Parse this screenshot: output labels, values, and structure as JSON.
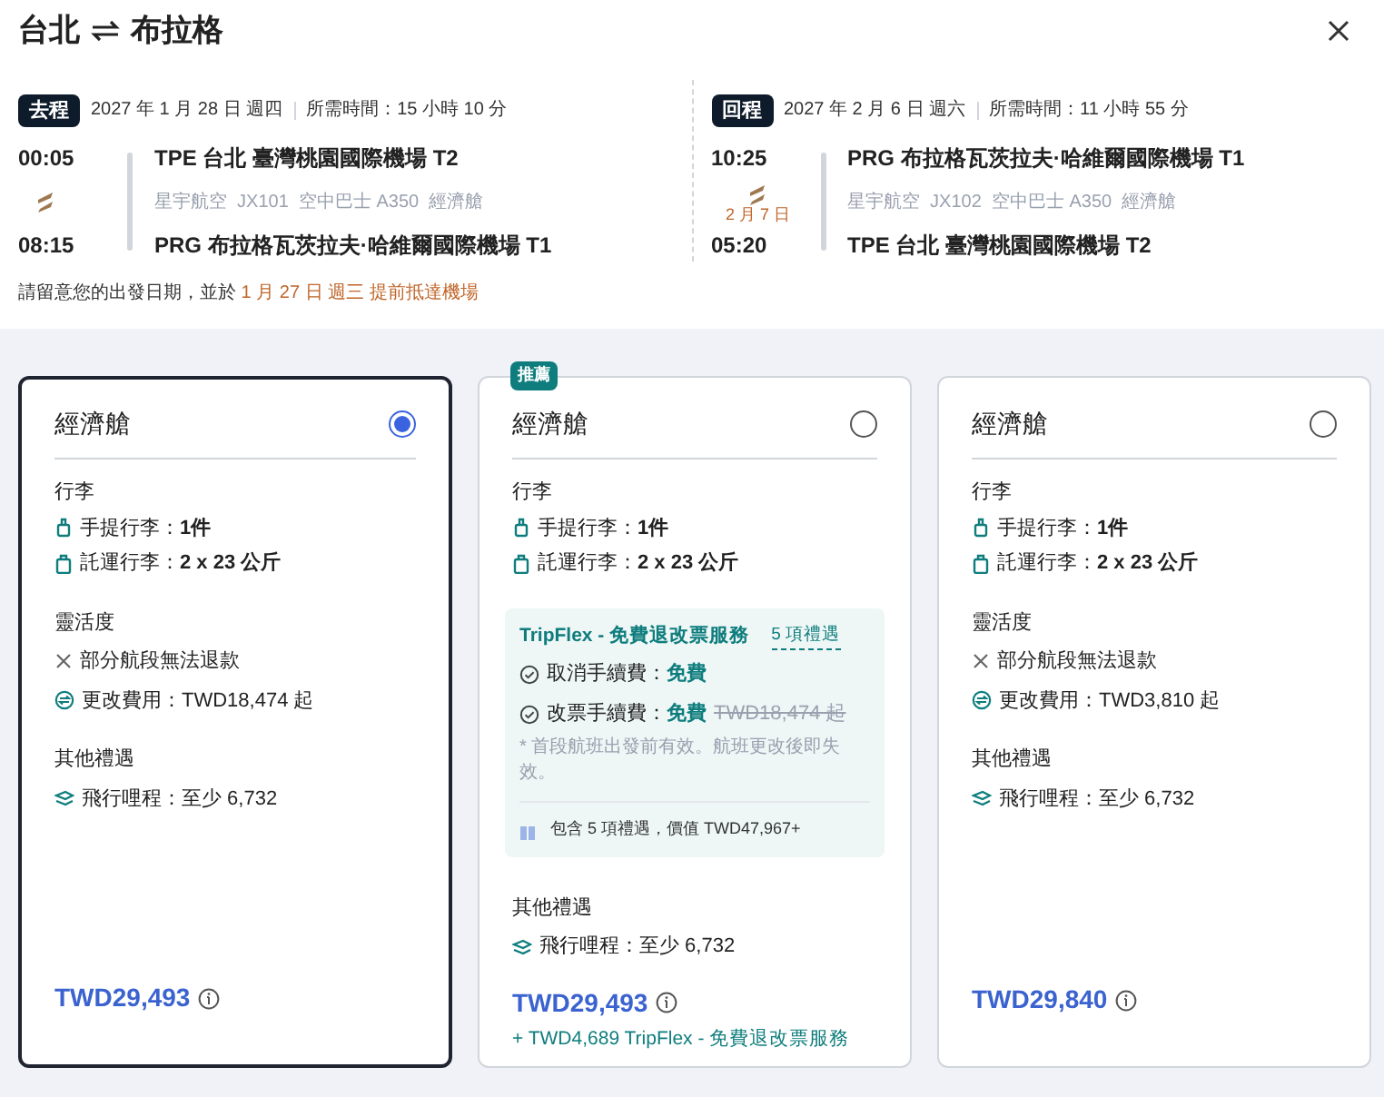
{
  "title": {
    "from": "台北",
    "to": "布拉格"
  },
  "legs": [
    {
      "tag": "去程",
      "date": "2027 年 1 月 28 日 週四",
      "duration": "所需時間：15 小時 10 分",
      "depart_time": "00:05",
      "depart_airport": "TPE 台北 臺灣桃園國際機場 T2",
      "flight_info": "星宇航空  JX101  空中巴士 A350  經濟艙",
      "arrive_time": "08:15",
      "arrive_airport": "PRG 布拉格瓦茨拉夫·哈維爾國際機場 T1"
    },
    {
      "tag": "回程",
      "date": "2027 年 2 月 6 日 週六",
      "duration": "所需時間：11 小時 55 分",
      "depart_time": "10:25",
      "depart_airport": "PRG 布拉格瓦茨拉夫·哈維爾國際機場 T1",
      "flight_info": "星宇航空  JX102  空中巴士 A350  經濟艙",
      "arrive_date": "2 月 7 日",
      "arrive_time": "05:20",
      "arrive_airport": "TPE 台北 臺灣桃園國際機場 T2"
    }
  ],
  "notice": {
    "text": "請留意您的出發日期，並於",
    "highlight": "1 月 27 日 週三 提前抵達機場"
  },
  "cards": [
    {
      "selected": true,
      "cabin": "經濟艙",
      "baggage_title": "行李",
      "baggage": [
        {
          "kind": "carry_on",
          "label": "手提行李：",
          "value": "1件"
        },
        {
          "kind": "checked",
          "label": "託運行李：",
          "value": "2 x 23 公斤"
        }
      ],
      "flexibility_title": "靈活度",
      "flexibility": [
        {
          "kind": "no_refund",
          "text": "部分航段無法退款"
        },
        {
          "kind": "change_fee",
          "text": "更改費用：TWD18,474 起"
        }
      ],
      "other_title": "其他禮遇",
      "other": [
        "飛行哩程：至少 6,732"
      ],
      "price": "TWD29,493"
    },
    {
      "selected": false,
      "badge": "推薦",
      "cabin": "經濟艙",
      "baggage_title": "行李",
      "baggage": [
        {
          "kind": "carry_on",
          "label": "手提行李：",
          "value": "1件"
        },
        {
          "kind": "checked",
          "label": "託運行李：",
          "value": "2 x 23 公斤"
        }
      ],
      "tripflex": {
        "title": "TripFlex - 免費退改票服務",
        "link": "5 項禮遇",
        "items": [
          {
            "label": "取消手續費：",
            "value": "免費"
          },
          {
            "label": "改票手續費：",
            "value": "免費",
            "struck": "TWD18,474 起"
          }
        ],
        "note": "* 首段航班出發前有效。航班更改後即失效。",
        "footer": "包含 5 項禮遇，價值 TWD47,967+"
      },
      "other_title": "其他禮遇",
      "other": [
        "飛行哩程：至少 6,732"
      ],
      "price": "TWD29,493",
      "addon": "+ TWD4,689 TripFlex - 免費退改票服務"
    },
    {
      "selected": false,
      "cabin": "經濟艙",
      "baggage_title": "行李",
      "baggage": [
        {
          "kind": "carry_on",
          "label": "手提行李：",
          "value": "1件"
        },
        {
          "kind": "checked",
          "label": "託運行李：",
          "value": "2 x 23 公斤"
        }
      ],
      "flexibility_title": "靈活度",
      "flexibility": [
        {
          "kind": "no_refund",
          "text": "部分航段無法退款"
        },
        {
          "kind": "change_fee",
          "text": "更改費用：TWD3,810 起"
        }
      ],
      "other_title": "其他禮遇",
      "other": [
        "飛行哩程：至少 6,732"
      ],
      "price": "TWD29,840"
    }
  ]
}
